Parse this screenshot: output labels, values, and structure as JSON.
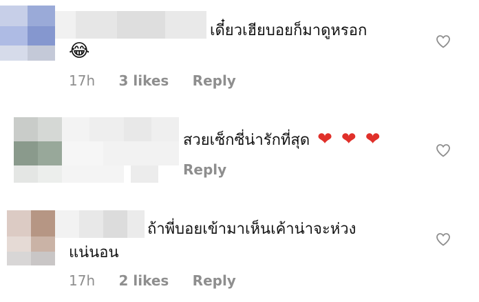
{
  "comments": [
    {
      "text": "เดี๋ยวเฮียบอยก็มาดูหรอก",
      "emoji": "😂",
      "time": "17h",
      "likes": "3 likes",
      "reply": "Reply"
    },
    {
      "text": "สวยเซ็กซี่น่ารักที่สุด",
      "hearts": [
        "❤",
        "❤",
        "❤"
      ],
      "reply": "Reply"
    },
    {
      "text_line1": "ถ้าพี่บอยเข้ามาเห็นเค้าน่าจะห่วง",
      "text_line2": "แน่นอน",
      "time": "17h",
      "likes": "2 likes",
      "reply": "Reply"
    }
  ],
  "icons": {
    "like": "heart-outline-icon"
  },
  "colors": {
    "meta": "#8e8e8e",
    "heart_emoji": "#e0302a"
  }
}
